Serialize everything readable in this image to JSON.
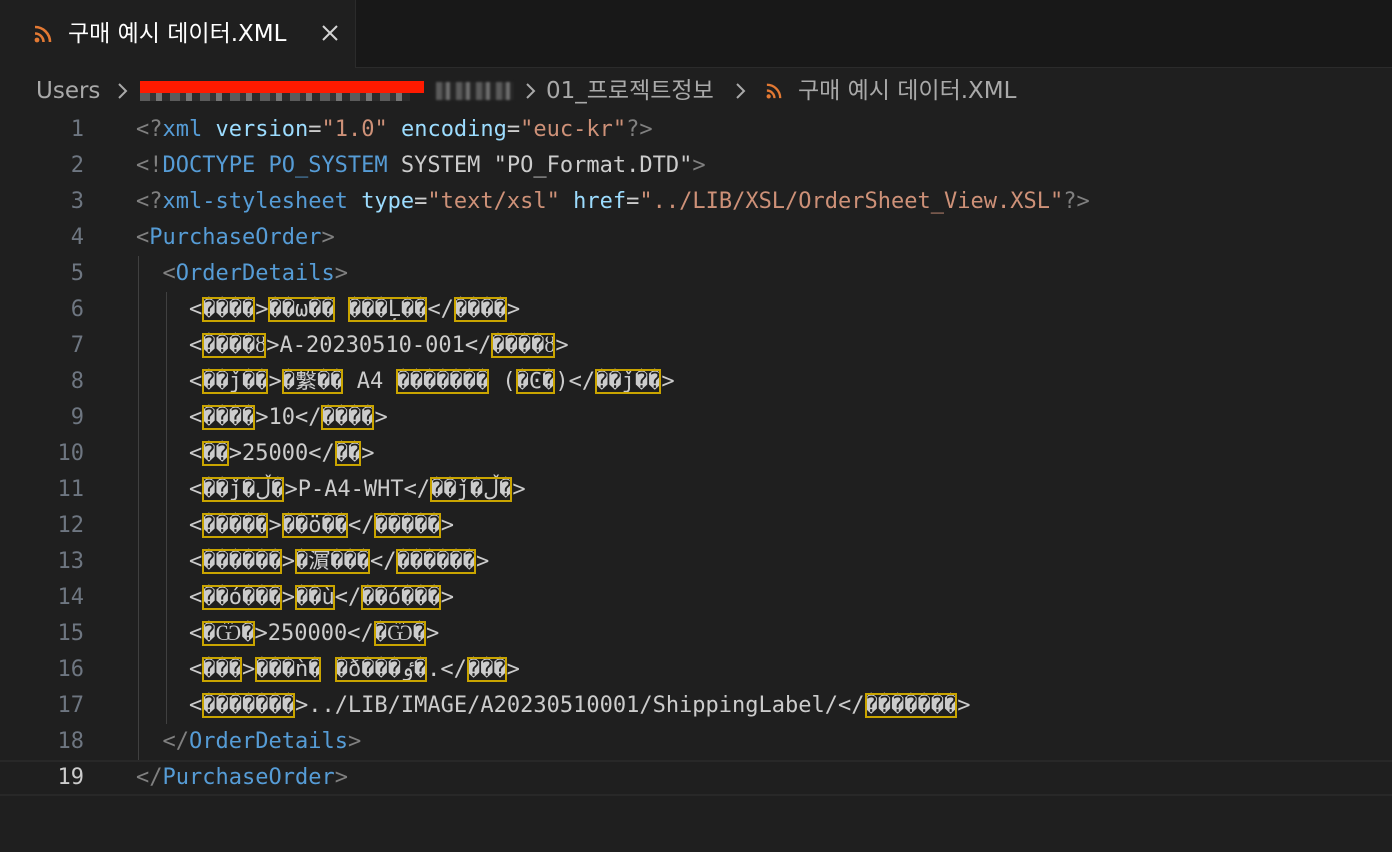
{
  "tab": {
    "title": "구매 예시 데이터.XML",
    "icon": "rss-icon",
    "close_icon": "close-icon",
    "accent": "#e37933"
  },
  "breadcrumb": {
    "items": [
      "Users",
      "01_프로젝트정보",
      "구매 예시 데이터.XML"
    ],
    "separator_icon": "chevron-right-icon"
  },
  "editor": {
    "current_line": 19,
    "lines": [
      {
        "n": "1",
        "tokens": [
          [
            "punc",
            "<?"
          ],
          [
            "tag",
            "xml"
          ],
          [
            "text",
            " "
          ],
          [
            "attr",
            "version"
          ],
          [
            "text",
            "="
          ],
          [
            "str",
            "\"1.0\""
          ],
          [
            "text",
            " "
          ],
          [
            "attr",
            "encoding"
          ],
          [
            "text",
            "="
          ],
          [
            "str",
            "\"euc-kr\""
          ],
          [
            "punc",
            "?>"
          ]
        ]
      },
      {
        "n": "2",
        "tokens": [
          [
            "punc",
            "<!"
          ],
          [
            "tag",
            "DOCTYPE PO_SYSTEM"
          ],
          [
            "text",
            " SYSTEM \"PO_Format.DTD\""
          ],
          [
            "punc",
            ">"
          ]
        ]
      },
      {
        "n": "3",
        "tokens": [
          [
            "punc",
            "<?"
          ],
          [
            "tag",
            "xml-stylesheet"
          ],
          [
            "text",
            " "
          ],
          [
            "attr",
            "type"
          ],
          [
            "text",
            "="
          ],
          [
            "str",
            "\"text/xsl\""
          ],
          [
            "text",
            " "
          ],
          [
            "attr",
            "href"
          ],
          [
            "text",
            "="
          ],
          [
            "str",
            "\"../LIB/XSL/OrderSheet_View.XSL\""
          ],
          [
            "punc",
            "?>"
          ]
        ]
      },
      {
        "n": "4",
        "tokens": [
          [
            "punc",
            "<"
          ],
          [
            "tag",
            "PurchaseOrder"
          ],
          [
            "punc",
            ">"
          ]
        ]
      },
      {
        "n": "5",
        "tokens": [
          [
            "text",
            "  "
          ],
          [
            "punc",
            "<"
          ],
          [
            "tag",
            "OrderDetails"
          ],
          [
            "punc",
            ">"
          ]
        ]
      },
      {
        "n": "6",
        "tokens": [
          [
            "text",
            "    <"
          ],
          [
            "bad",
            "����"
          ],
          [
            "text",
            ">"
          ],
          [
            "bad",
            "��ω��"
          ],
          [
            "text",
            " "
          ],
          [
            "bad",
            "���L̦��"
          ],
          [
            "text",
            "</"
          ],
          [
            "bad",
            "����"
          ],
          [
            "text",
            ">"
          ]
        ]
      },
      {
        "n": "7",
        "tokens": [
          [
            "text",
            "    <"
          ],
          [
            "bad",
            "����ȣ"
          ],
          [
            "text",
            ">A-20230510-001</"
          ],
          [
            "bad",
            "����ȣ"
          ],
          [
            "text",
            ">"
          ]
        ]
      },
      {
        "n": "8",
        "tokens": [
          [
            "text",
            "    <"
          ],
          [
            "bad",
            "��ǰ��"
          ],
          [
            "text",
            ">"
          ],
          [
            "bad",
            "�繫��"
          ],
          [
            "text",
            " A4 "
          ],
          [
            "bad",
            "�������"
          ],
          [
            "text",
            " ("
          ],
          [
            "bad",
            "�Ͼ�"
          ],
          [
            "text",
            ")</"
          ],
          [
            "bad",
            "��ǰ��"
          ],
          [
            "text",
            ">"
          ]
        ]
      },
      {
        "n": "9",
        "tokens": [
          [
            "text",
            "    <"
          ],
          [
            "bad",
            "����"
          ],
          [
            "text",
            ">10</"
          ],
          [
            "bad",
            "����"
          ],
          [
            "text",
            ">"
          ]
        ]
      },
      {
        "n": "10",
        "tokens": [
          [
            "text",
            "    <"
          ],
          [
            "bad",
            "��"
          ],
          [
            "text",
            ">25000</"
          ],
          [
            "bad",
            "��"
          ],
          [
            "text",
            ">"
          ]
        ]
      },
      {
        "n": "11",
        "tokens": [
          [
            "text",
            "    <"
          ],
          [
            "bad",
            "��ǰ�ڵ�"
          ],
          [
            "text",
            ">P-A4-WHT</"
          ],
          [
            "bad",
            "��ǰ�ڵ�"
          ],
          [
            "text",
            ">"
          ]
        ]
      },
      {
        "n": "12",
        "tokens": [
          [
            "text",
            "    <"
          ],
          [
            "bad",
            "�����"
          ],
          [
            "text",
            ">"
          ],
          [
            "bad",
            "��ö��"
          ],
          [
            "text",
            "</"
          ],
          [
            "bad",
            "�����"
          ],
          [
            "text",
            ">"
          ]
        ]
      },
      {
        "n": "13",
        "tokens": [
          [
            "text",
            "    <"
          ],
          [
            "bad",
            "������"
          ],
          [
            "text",
            ">"
          ],
          [
            "bad",
            "�濵���"
          ],
          [
            "text",
            "</"
          ],
          [
            "bad",
            "������"
          ],
          [
            "text",
            ">"
          ]
        ]
      },
      {
        "n": "14",
        "tokens": [
          [
            "text",
            "    <"
          ],
          [
            "bad",
            "��ó���"
          ],
          [
            "text",
            ">"
          ],
          [
            "bad",
            "��ù"
          ],
          [
            "text",
            "</"
          ],
          [
            "bad",
            "��ó���"
          ],
          [
            "text",
            ">"
          ]
        ]
      },
      {
        "n": "15",
        "tokens": [
          [
            "text",
            "    <"
          ],
          [
            "bad",
            "�Ѿ�"
          ],
          [
            "text",
            ">250000</"
          ],
          [
            "bad",
            "�Ѿ�"
          ],
          [
            "text",
            ">"
          ]
        ]
      },
      {
        "n": "16",
        "tokens": [
          [
            "text",
            "    <"
          ],
          [
            "bad",
            "���"
          ],
          [
            "text",
            ">"
          ],
          [
            "bad",
            "���ǹ�"
          ],
          [
            "text",
            " "
          ],
          [
            "bad",
            "�ð���ٶ�"
          ],
          [
            "text",
            ".</"
          ],
          [
            "bad",
            "���"
          ],
          [
            "text",
            ">"
          ]
        ]
      },
      {
        "n": "17",
        "tokens": [
          [
            "text",
            "    <"
          ],
          [
            "bad",
            "�������"
          ],
          [
            "text",
            ">../LIB/IMAGE/A20230510001/ShippingLabel/</"
          ],
          [
            "bad",
            "�������"
          ],
          [
            "text",
            ">"
          ]
        ]
      },
      {
        "n": "18",
        "tokens": [
          [
            "text",
            "  "
          ],
          [
            "punc",
            "</"
          ],
          [
            "tag",
            "OrderDetails"
          ],
          [
            "punc",
            ">"
          ]
        ]
      },
      {
        "n": "19",
        "tokens": [
          [
            "punc",
            "</"
          ],
          [
            "tag",
            "PurchaseOrder"
          ],
          [
            "punc",
            ">"
          ]
        ]
      }
    ]
  }
}
